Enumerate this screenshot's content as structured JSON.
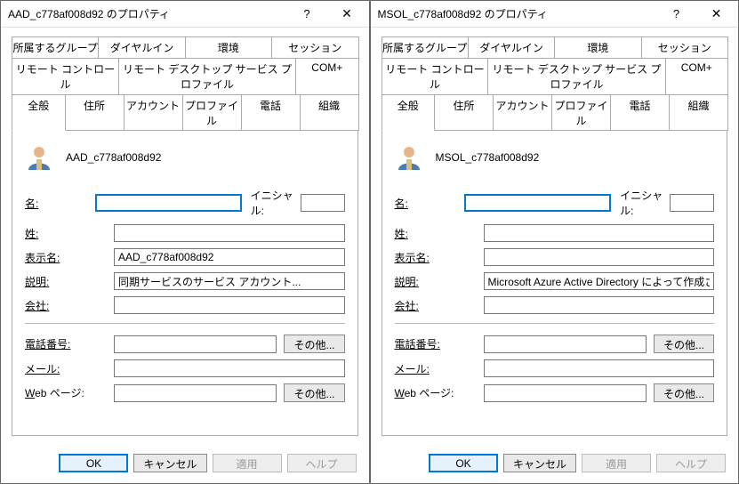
{
  "dialogs": [
    {
      "title": "AAD_c778af008d92 のプロパティ",
      "username": "AAD_c778af008d92",
      "fields": {
        "first": "",
        "initials": "",
        "last": "",
        "display": "AAD_c778af008d92",
        "desc": "同期サービスのサービス アカウント...",
        "company": "",
        "phone": "",
        "mail": "",
        "web": ""
      }
    },
    {
      "title": "MSOL_c778af008d92 のプロパティ",
      "username": "MSOL_c778af008d92",
      "fields": {
        "first": "",
        "initials": "",
        "last": "",
        "display": "",
        "desc": "Microsoft Azure Active Directory によって作成された...",
        "company": "",
        "phone": "",
        "mail": "",
        "web": ""
      }
    }
  ],
  "titlebar": {
    "help": "?",
    "close": "✕"
  },
  "tabs": {
    "row1": [
      "所属するグループ",
      "ダイヤルイン",
      "環境",
      "セッション"
    ],
    "row2": [
      "リモート コントロール",
      "リモート デスクトップ サービス プロファイル",
      "COM+"
    ],
    "row3": [
      "全般",
      "住所",
      "アカウント",
      "プロファイル",
      "電話",
      "組織"
    ]
  },
  "labels": {
    "first": "名:",
    "initials": "イニシャル:",
    "last": "姓:",
    "display": "表示名:",
    "desc": "説明:",
    "company": "会社:",
    "phone": "電話番号:",
    "mail": "メール:",
    "web": "Web ページ:",
    "other": "その他..."
  },
  "footer": {
    "ok": "OK",
    "cancel": "キャンセル",
    "apply": "適用",
    "help": "ヘルプ"
  }
}
